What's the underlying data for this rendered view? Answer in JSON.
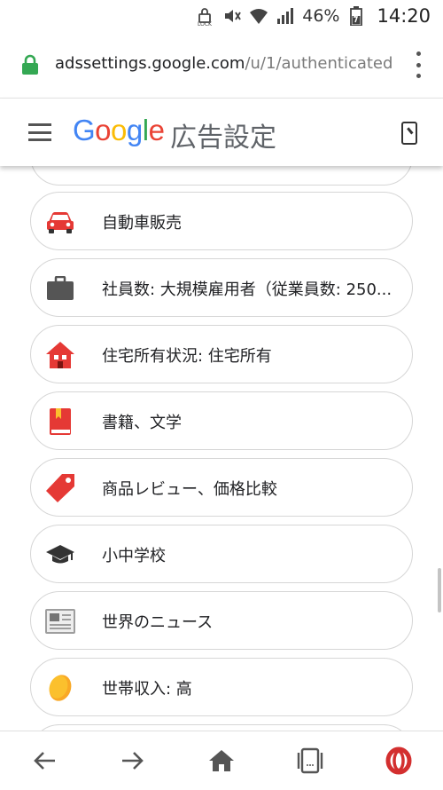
{
  "status_bar": {
    "battery_percent": "46%",
    "time": "14:20",
    "icons": [
      "lock-screen-icon",
      "mute-icon",
      "wifi-icon",
      "signal-icon",
      "battery-icon"
    ]
  },
  "browser": {
    "url_host": "adssettings.google.com",
    "url_path": "/u/1/authenticated",
    "secure": true
  },
  "app_header": {
    "logo_text": "Google",
    "title": "広告設定"
  },
  "interests": [
    {
      "label": "自動車販売",
      "icon": "car-icon"
    },
    {
      "label": "社員数: 大規模雇用者（従業員数: 250...",
      "icon": "briefcase-icon"
    },
    {
      "label": "住宅所有状況: 住宅所有",
      "icon": "house-icon"
    },
    {
      "label": "書籍、文学",
      "icon": "book-icon"
    },
    {
      "label": "商品レビュー、価格比較",
      "icon": "price-tag-icon"
    },
    {
      "label": "小中学校",
      "icon": "graduation-cap-icon"
    },
    {
      "label": "世界のニュース",
      "icon": "newspaper-icon"
    },
    {
      "label": "世帯収入: 高",
      "icon": "coin-icon"
    }
  ],
  "bottom_nav": [
    "back-icon",
    "forward-icon",
    "home-icon",
    "tabs-icon",
    "opera-icon"
  ],
  "colors": {
    "google_blue": "#4285F4",
    "google_red": "#EA4335",
    "google_yellow": "#FBBC05",
    "google_green": "#34A853",
    "secure_lock": "#34A853",
    "card_border": "#d6d6d6"
  }
}
